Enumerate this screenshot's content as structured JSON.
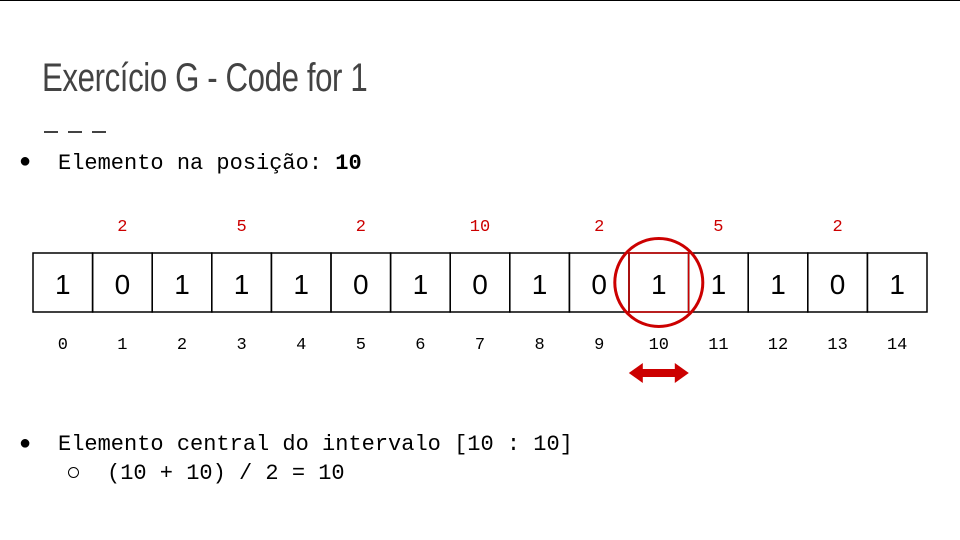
{
  "slide": {
    "title": "Exercício G - Code for 1",
    "bullet1": {
      "label": "Elemento na posição: ",
      "value": "10"
    },
    "bullet2": {
      "label": "Elemento central do intervalo [10 : 10]",
      "sub": "(10 + 10) / 2 = 10"
    }
  },
  "array": {
    "cells": [
      "1",
      "0",
      "1",
      "1",
      "1",
      "0",
      "1",
      "0",
      "1",
      "0",
      "1",
      "1",
      "1",
      "0",
      "1"
    ],
    "indices": [
      "0",
      "1",
      "2",
      "3",
      "4",
      "5",
      "6",
      "7",
      "8",
      "9",
      "10",
      "11",
      "12",
      "13",
      "14"
    ],
    "step_labels": [
      {
        "index": 1,
        "text": "2"
      },
      {
        "index": 3,
        "text": "5"
      },
      {
        "index": 5,
        "text": "2"
      },
      {
        "index": 7,
        "text": "10"
      },
      {
        "index": 9,
        "text": "2"
      },
      {
        "index": 11,
        "text": "5"
      },
      {
        "index": 13,
        "text": "2"
      }
    ],
    "highlight_index": 10
  },
  "colors": {
    "accent": "#cc0000",
    "title": "#434343",
    "text": "#000000"
  },
  "icons": {
    "bullet": "filled-circle",
    "sub_bullet": "hollow-circle",
    "range_arrow": "double-headed-arrow-icon",
    "highlight": "circle-highlight-icon"
  }
}
